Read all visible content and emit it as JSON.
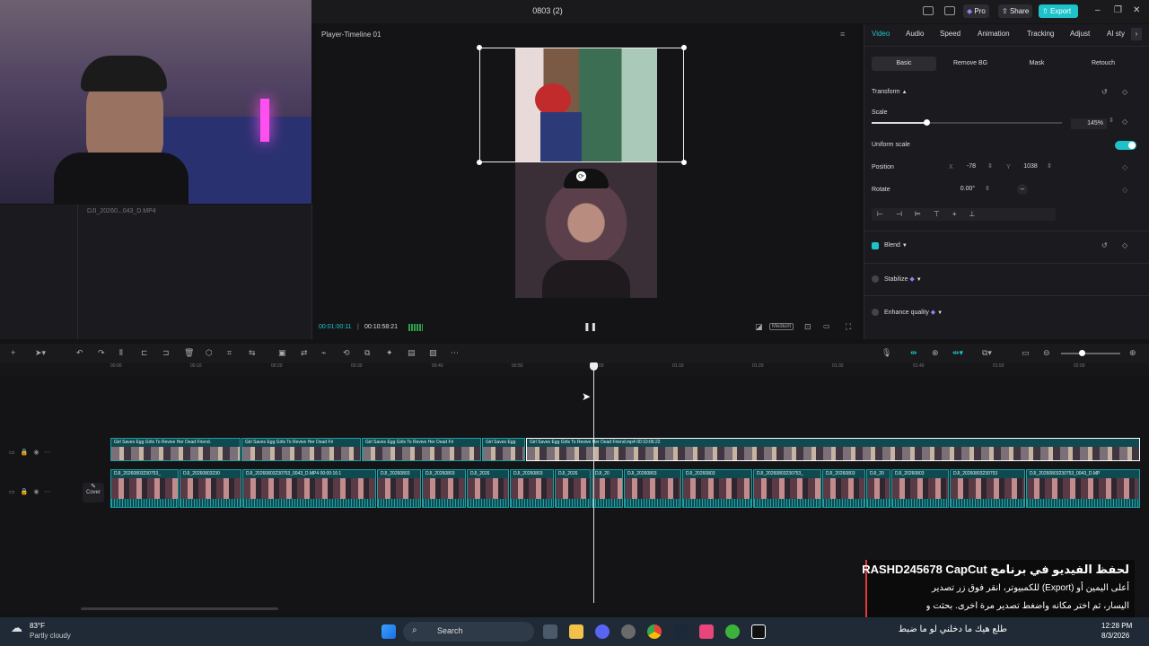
{
  "window": {
    "title": "0803 (2)",
    "pro": "Pro",
    "share": "Share",
    "export": "Export"
  },
  "media": {
    "filename": "DJI_20260...043_D.MP4"
  },
  "player": {
    "title": "Player-Timeline 01",
    "current_time": "00:01:00:11",
    "duration": "00:10:58:21",
    "quality": "Medium"
  },
  "inspector": {
    "tabs": [
      "Video",
      "Audio",
      "Speed",
      "Animation",
      "Tracking",
      "Adjust",
      "AI sty"
    ],
    "subtabs": [
      "Basic",
      "Remove BG",
      "Mask",
      "Retouch"
    ],
    "transform_label": "Transform",
    "scale_label": "Scale",
    "scale_value": "145%",
    "scale_fraction": 0.29,
    "uniform_scale_label": "Uniform scale",
    "position_label": "Position",
    "pos_x_label": "X",
    "pos_x": "-78",
    "pos_y_label": "Y",
    "pos_y": "1038",
    "rotate_label": "Rotate",
    "rotate_value": "0.00°",
    "blend_label": "Blend",
    "stabilize_label": "Stabilize",
    "enhance_label": "Enhance quality"
  },
  "timeline": {
    "ticks": [
      "00:00",
      "00:10",
      "00:20",
      "00:30",
      "00:40",
      "00:50",
      "01:00",
      "01:10",
      "01:20",
      "01:30",
      "01:40",
      "01:50",
      "02:00"
    ],
    "cover_label": "Cover",
    "track1": [
      "Girl Saves Egg Girls To Revive Her Dead Friend.",
      "Girl Saves Egg Girls To Revive Her Dead Fri",
      "Girl Saves Egg Girls To Revive Her Dead Fri",
      "Girl Saves Egg",
      "Girl Saves Egg Girls To Revive Her Dead Friend.mp4  00:10:06:22"
    ],
    "track2": [
      "DJI_20260803230753_",
      "DJI_20260803230",
      "DJI_20260803230753_0043_D.MP4  00:00:16:1",
      "DJI_20260803",
      "DJI_20260803",
      "DJI_2026",
      "DJI_20260803",
      "DJI_2026",
      "DJI_20",
      "DJI_20260803",
      "DJI_20260803",
      "DJI_20260803230753_",
      "DJI_20260803",
      "DJI_20",
      "DJI_20260803",
      "DJI_20260803230753",
      "DJI_20260803230753_0043_D.MP"
    ]
  },
  "overlay": {
    "line1": "لحفظ الفيديو في برنامج RASHD245678 CapCut",
    "line2": "أعلى اليمين أو (Export) للكمبيوتر، انقر فوق زر تصدير",
    "line3": "اليسار، ثم اختر مكانه واضغط تصدير مرة أخرى. بحثت و",
    "line4": "طلع هيك ما دخلني لو ما ضبط"
  },
  "taskbar": {
    "temp": "83°F",
    "weather": "Partly cloudy",
    "search": "Search",
    "time": "12:28 PM",
    "date": "8/3/2026"
  },
  "colors": {
    "accent": "#1dc3c9",
    "clip_border": "#1c9fa3",
    "overlay_bar": "#e03a3a"
  }
}
